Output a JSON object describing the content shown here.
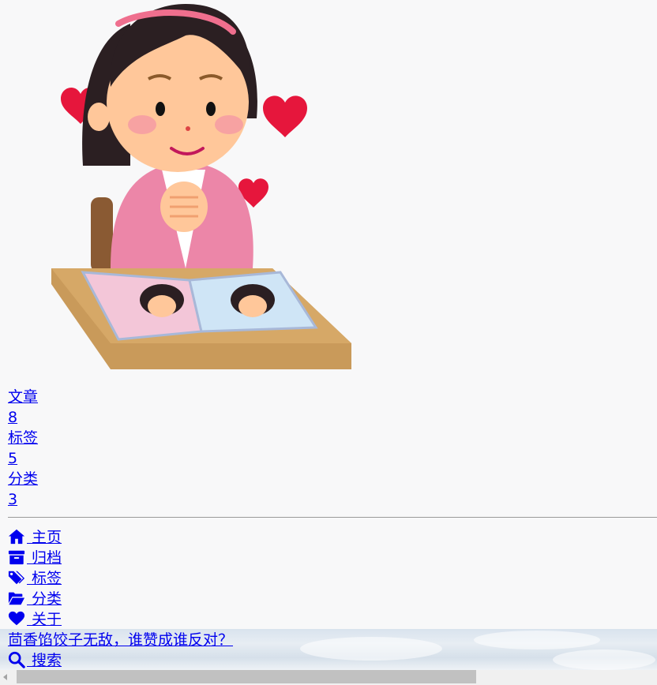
{
  "stats": [
    {
      "label": "文章",
      "count": "8"
    },
    {
      "label": "标签",
      "count": "5"
    },
    {
      "label": "分类",
      "count": "3"
    }
  ],
  "menu": [
    {
      "icon": "home-icon",
      "label": " 主页"
    },
    {
      "icon": "archive-icon",
      "label": " 归档"
    },
    {
      "icon": "tags-icon",
      "label": " 标签"
    },
    {
      "icon": "folder-open-icon",
      "label": " 分类"
    },
    {
      "icon": "heart-icon",
      "label": " 关于"
    }
  ],
  "slogan": "茴香馅饺子无敌，谁赞成谁反对？",
  "search_label": " 搜索",
  "colors": {
    "link": "#0000ee",
    "background": "#f8f8f9",
    "heart": "#e02040"
  }
}
